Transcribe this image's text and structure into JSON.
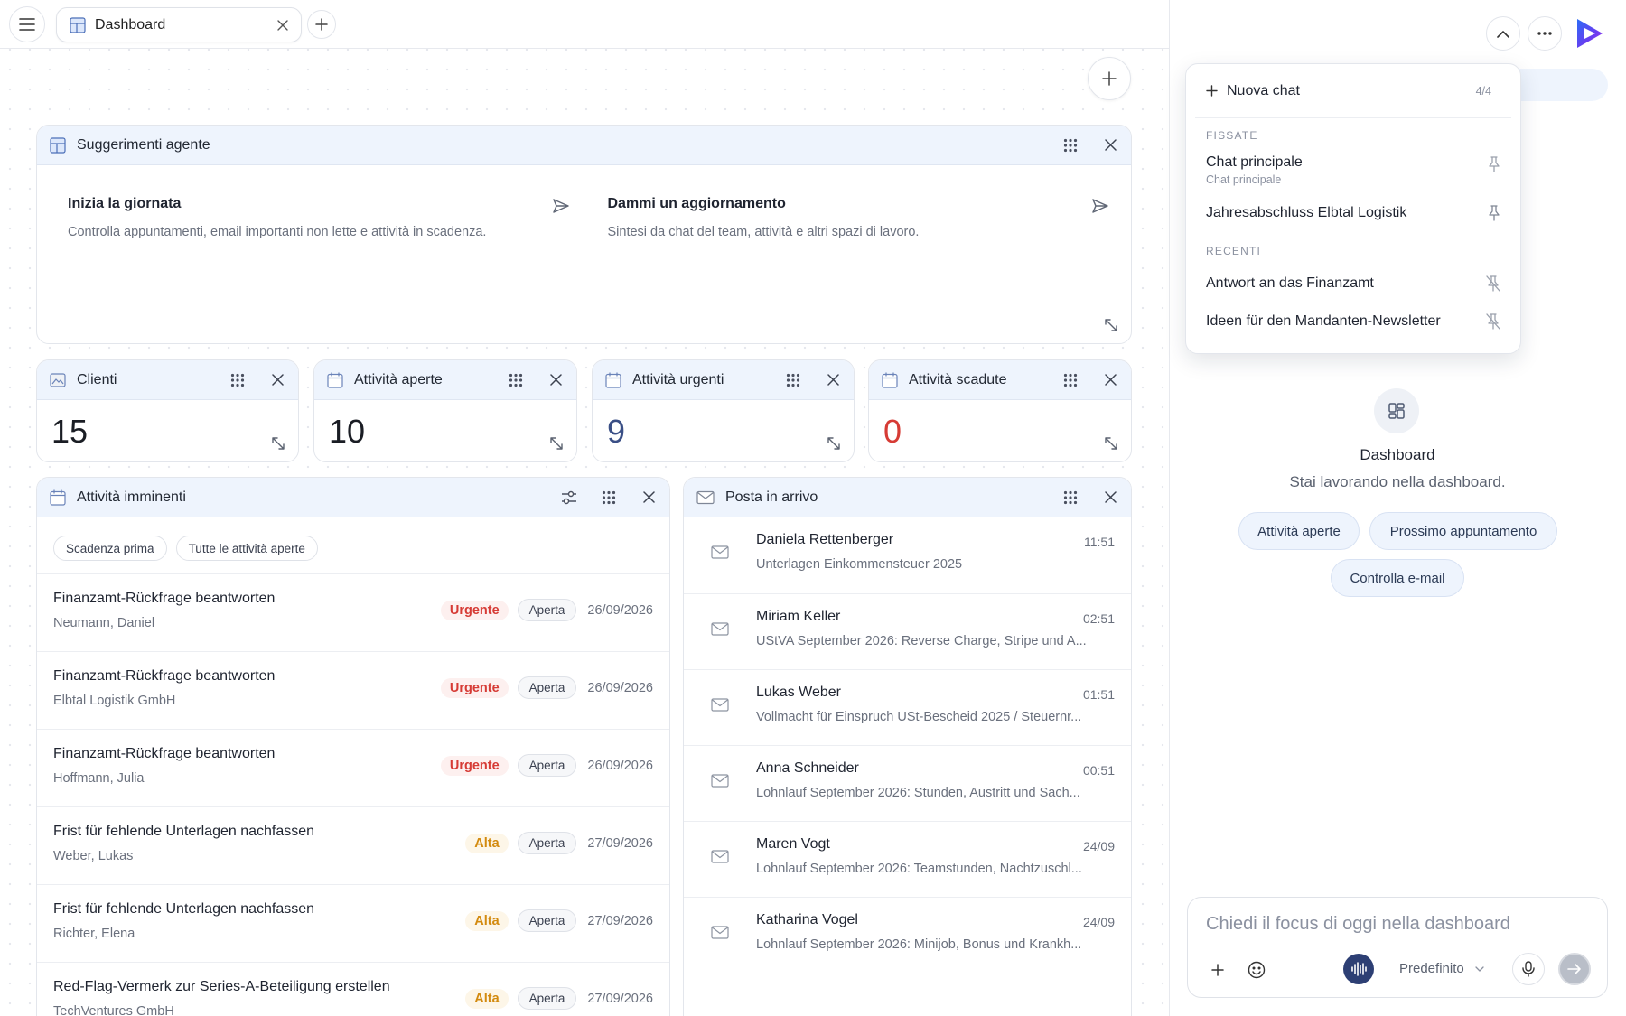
{
  "tab": {
    "label": "Dashboard"
  },
  "suggestions": {
    "title": "Suggerimenti agente",
    "items": [
      {
        "title": "Inizia la giornata",
        "desc": "Controlla appuntamenti, email importanti non lette e attività in scadenza."
      },
      {
        "title": "Dammi un aggiornamento",
        "desc": "Sintesi da chat del team, attività e altri spazi di lavoro."
      }
    ]
  },
  "stats": [
    {
      "title": "Clienti",
      "value": "15",
      "color": "#1a1d24"
    },
    {
      "title": "Attività aperte",
      "value": "10",
      "color": "#1a1d24"
    },
    {
      "title": "Attività urgenti",
      "value": "9",
      "color": "#3a4f86"
    },
    {
      "title": "Attività scadute",
      "value": "0",
      "color": "#d63b35"
    }
  ],
  "tasks": {
    "title": "Attività imminenti",
    "filters": [
      "Scadenza prima",
      "Tutte le attività aperte"
    ],
    "rows": [
      {
        "title": "Finanzamt-Rückfrage beantworten",
        "client": "Neumann, Daniel",
        "priority": "Urgente",
        "prio_type": "urg",
        "status": "Aperta",
        "date": "26/09/2026"
      },
      {
        "title": "Finanzamt-Rückfrage beantworten",
        "client": "Elbtal Logistik GmbH",
        "priority": "Urgente",
        "prio_type": "urg",
        "status": "Aperta",
        "date": "26/09/2026"
      },
      {
        "title": "Finanzamt-Rückfrage beantworten",
        "client": "Hoffmann, Julia",
        "priority": "Urgente",
        "prio_type": "urg",
        "status": "Aperta",
        "date": "26/09/2026"
      },
      {
        "title": "Frist für fehlende Unterlagen nachfassen",
        "client": "Weber, Lukas",
        "priority": "Alta",
        "prio_type": "alta",
        "status": "Aperta",
        "date": "27/09/2026"
      },
      {
        "title": "Frist für fehlende Unterlagen nachfassen",
        "client": "Richter, Elena",
        "priority": "Alta",
        "prio_type": "alta",
        "status": "Aperta",
        "date": "27/09/2026"
      },
      {
        "title": "Red-Flag-Vermerk zur Series-A-Beteiligung erstellen",
        "client": "TechVentures GmbH",
        "priority": "Alta",
        "prio_type": "alta",
        "status": "Aperta",
        "date": "27/09/2026"
      }
    ]
  },
  "inbox": {
    "title": "Posta in arrivo",
    "rows": [
      {
        "from": "Daniela Rettenberger",
        "time": "11:51",
        "subject": "Unterlagen Einkommensteuer 2025"
      },
      {
        "from": "Miriam Keller",
        "time": "02:51",
        "subject": "UStVA September 2026: Reverse Charge, Stripe und A..."
      },
      {
        "from": "Lukas Weber",
        "time": "01:51",
        "subject": "Vollmacht für Einspruch USt-Bescheid 2025 / Steuernr..."
      },
      {
        "from": "Anna Schneider",
        "time": "00:51",
        "subject": "Lohnlauf September 2026: Stunden, Austritt und Sach..."
      },
      {
        "from": "Maren Vogt",
        "time": "24/09",
        "subject": "Lohnlauf September 2026: Teamstunden, Nachtzuschl..."
      },
      {
        "from": "Katharina Vogel",
        "time": "24/09",
        "subject": "Lohnlauf September 2026: Minijob, Bonus und Krankh..."
      }
    ]
  },
  "chat_menu": {
    "new_chat": "Nuova chat",
    "count": "4/4",
    "pinned_label": "FISSATE",
    "pinned": [
      {
        "name": "Chat principale",
        "sub": "Chat principale"
      },
      {
        "name": "Jahresabschluss Elbtal Logistik",
        "sub": ""
      }
    ],
    "recent_label": "RECENTI",
    "recent": [
      {
        "name": "Antwort an das Finanzamt"
      },
      {
        "name": "Ideen für den Mandanten-Newsletter"
      }
    ]
  },
  "agent": {
    "title": "Dashboard",
    "subtitle": "Stai lavorando nella dashboard.",
    "actions": [
      "Attività aperte",
      "Prossimo appuntamento",
      "Controlla e-mail"
    ]
  },
  "composer": {
    "placeholder": "Chiedi il focus di oggi nella dashboard",
    "model": "Predefinito"
  }
}
